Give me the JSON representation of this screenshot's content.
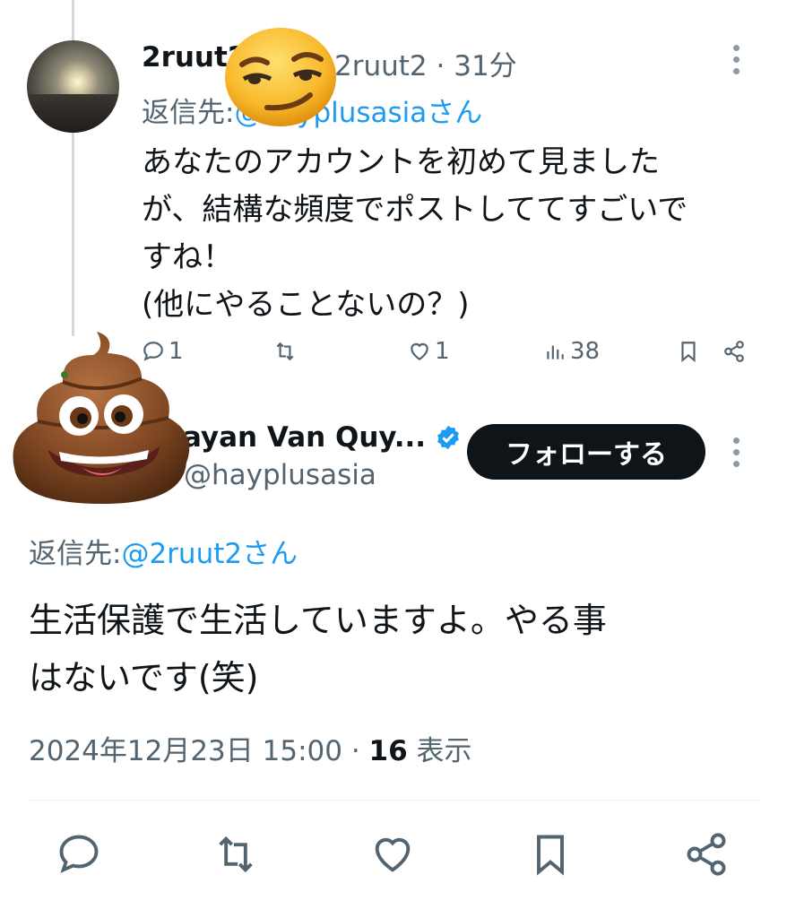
{
  "reply_tweet": {
    "display_name": "2ruut2",
    "handle": "@2ruut2",
    "time": "· 31分",
    "reply_prefix": "返信先:",
    "reply_target": "@hayplusasiaさん",
    "text_lines": [
      "あなたのアカウントを初めて見ました",
      "が、結構な頻度でポストしててすごいで",
      "すね！",
      "(他にやることないの？)"
    ],
    "actions": {
      "reply_count": "1",
      "retweet_count": "",
      "like_count": "1",
      "views_count": "38"
    }
  },
  "main_tweet": {
    "display_name": "Hayan Van Quy...",
    "handle": "@hayplusasia",
    "follow_label": "フォローする",
    "reply_prefix": "返信先:",
    "reply_target": "@2ruut2さん",
    "text_lines": [
      "生活保護で生活していますよ。やる事",
      "はないです(笑)"
    ],
    "timestamp": "2024年12月23日 15:00 · ",
    "views_count": "16",
    "views_label": " 表示"
  },
  "stickers": [
    "smirking-face-emoji",
    "pile-of-poo-emoji"
  ],
  "icons": [
    "reply-icon",
    "retweet-icon",
    "like-icon",
    "views-icon",
    "bookmark-icon",
    "share-icon",
    "more-icon",
    "verified-badge-icon"
  ],
  "colors": {
    "link": "#1d9bf0",
    "muted": "#536471",
    "text": "#0f1419",
    "follow_bg": "#0f1419",
    "verified": "#1d9bf0"
  }
}
